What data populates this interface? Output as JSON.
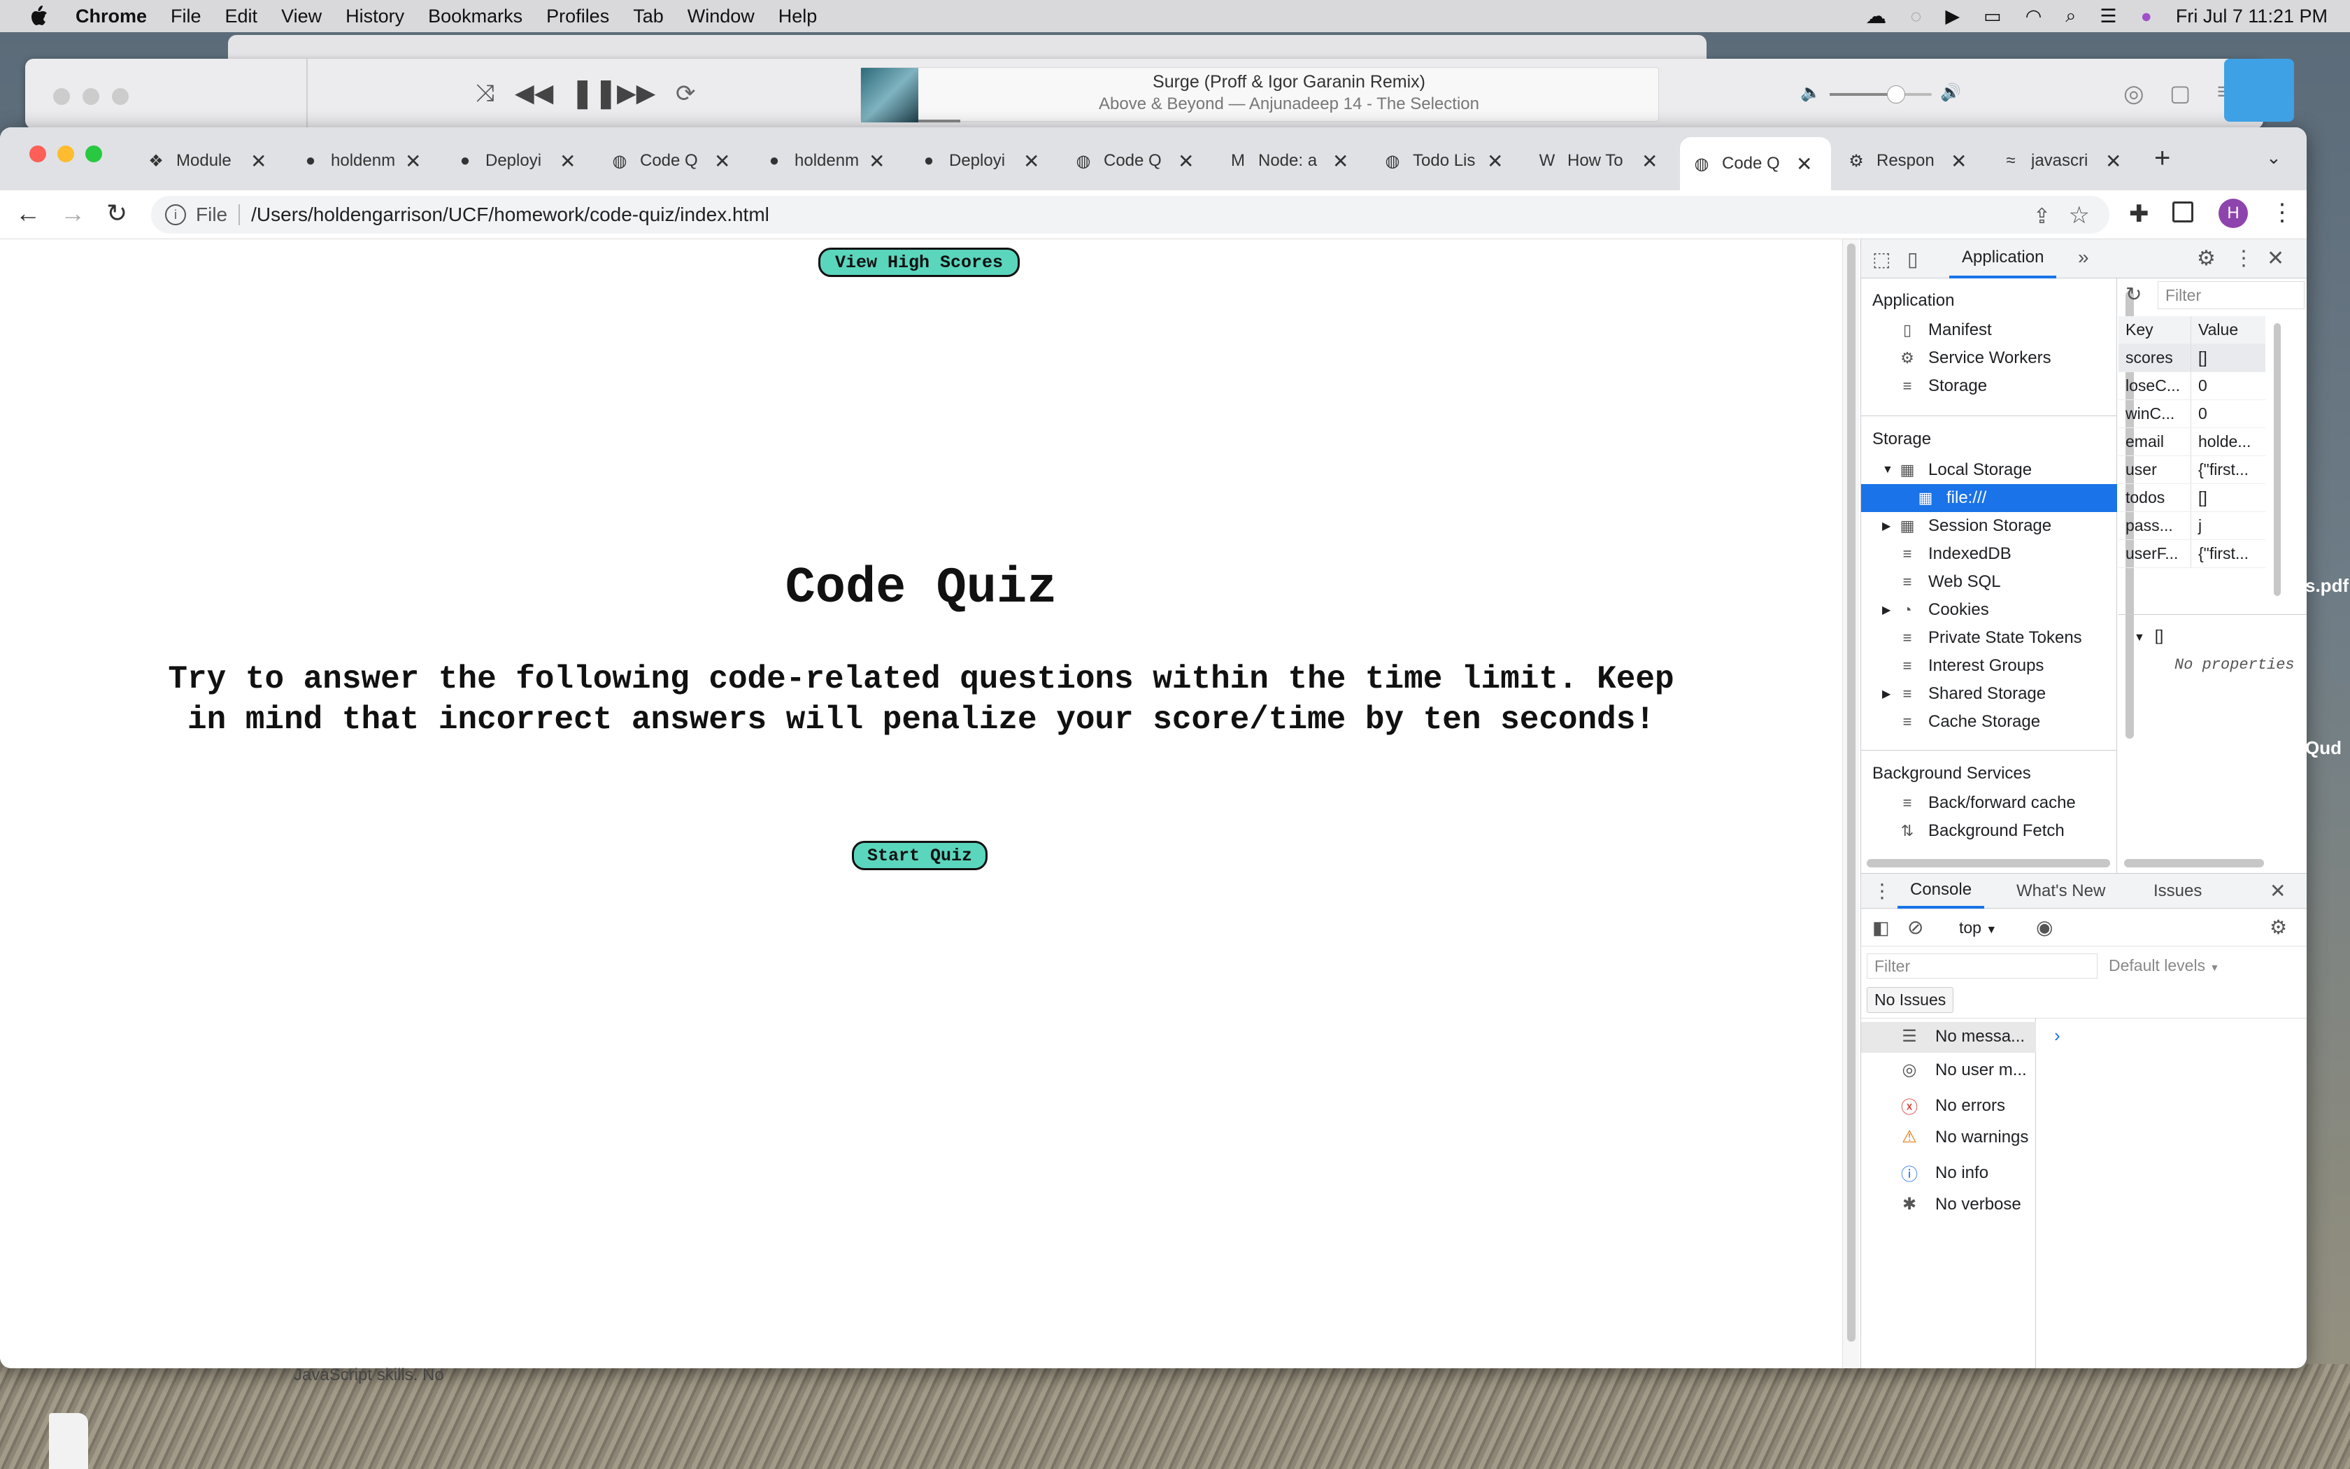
{
  "menubar": {
    "apple": "",
    "app_name": "Chrome",
    "items": [
      "File",
      "Edit",
      "View",
      "History",
      "Bookmarks",
      "Profiles",
      "Tab",
      "Window",
      "Help"
    ],
    "clock": "Fri Jul 7  11:21 PM"
  },
  "music": {
    "track_title": "Surge (Proff & Igor Garanin Remix)",
    "track_subtitle": "Above & Beyond — Anjunadeep 14 - The Selection",
    "volume": 0.65
  },
  "tabs": [
    {
      "label": "Module",
      "icon": "swirl-icon"
    },
    {
      "label": "holdenm",
      "icon": "github-icon"
    },
    {
      "label": "Deployi",
      "icon": "github-icon"
    },
    {
      "label": "Code Q",
      "icon": "globe-icon"
    },
    {
      "label": "holdenm",
      "icon": "github-icon"
    },
    {
      "label": "Deployi",
      "icon": "github-icon"
    },
    {
      "label": "Code Q",
      "icon": "globe-icon"
    },
    {
      "label": "Node: a",
      "icon": "medium-icon"
    },
    {
      "label": "Todo Lis",
      "icon": "globe-icon"
    },
    {
      "label": "How To",
      "icon": "w-icon"
    },
    {
      "label": "Code Q",
      "icon": "globe-icon"
    },
    {
      "label": "Respon",
      "icon": "gear-icon"
    },
    {
      "label": "javascri",
      "icon": "js-icon"
    }
  ],
  "active_tab_index": 10,
  "toolbar": {
    "scheme": "File",
    "url": "/Users/holdengarrison/UCF/homework/code-quiz/index.html",
    "profile_initial": "H"
  },
  "page": {
    "high_scores_button": "View High Scores",
    "title": "Code Quiz",
    "description": "Try to answer the following code-related questions within the time limit. Keep in mind that incorrect answers will penalize your score/time by ten seconds!",
    "start_button": "Start Quiz"
  },
  "devtools": {
    "active_panel": "Application",
    "filter_placeholder": "Filter",
    "application_header": "Application",
    "application_items": [
      "Manifest",
      "Service Workers",
      "Storage"
    ],
    "storage_header": "Storage",
    "storage_items": [
      "Local Storage",
      "file:///",
      "Session Storage",
      "IndexedDB",
      "Web SQL",
      "Cookies",
      "Private State Tokens",
      "Interest Groups",
      "Shared Storage",
      "Cache Storage"
    ],
    "background_header": "Background Services",
    "background_items": [
      "Back/forward cache",
      "Background Fetch"
    ],
    "table_headers": {
      "key": "Key",
      "value": "Value"
    },
    "rows": [
      {
        "key": "scores",
        "value": "[]"
      },
      {
        "key": "loseC...",
        "value": "0"
      },
      {
        "key": "winC...",
        "value": "0"
      },
      {
        "key": "email",
        "value": "holde..."
      },
      {
        "key": "user",
        "value": "{\"first..."
      },
      {
        "key": "todos",
        "value": "[]"
      },
      {
        "key": "pass...",
        "value": "j"
      },
      {
        "key": "userF...",
        "value": "{\"first..."
      }
    ],
    "preview_root": "[]",
    "preview_empty": "No properties",
    "console": {
      "tabs": [
        "Console",
        "What's New",
        "Issues"
      ],
      "context": "top",
      "filter_placeholder": "Filter",
      "levels": "Default levels",
      "issues_badge": "No Issues",
      "messages": [
        {
          "label": "No messa...",
          "icon": "list-icon"
        },
        {
          "label": "No user m...",
          "icon": "user-icon"
        },
        {
          "label": "No errors",
          "icon": "error-icon"
        },
        {
          "label": "No warnings",
          "icon": "warning-icon"
        },
        {
          "label": "No info",
          "icon": "info-icon"
        },
        {
          "label": "No verbose",
          "icon": "bug-icon"
        }
      ]
    }
  },
  "desktop": {
    "label_pdf": "s.pdf",
    "label_qud": "Qud",
    "behind_text": "JavaScript skills. No"
  },
  "colors": {
    "button_green": "#5ad6bd",
    "devtools_selected": "#1a73e8",
    "menubar": "#d9d9dc"
  }
}
